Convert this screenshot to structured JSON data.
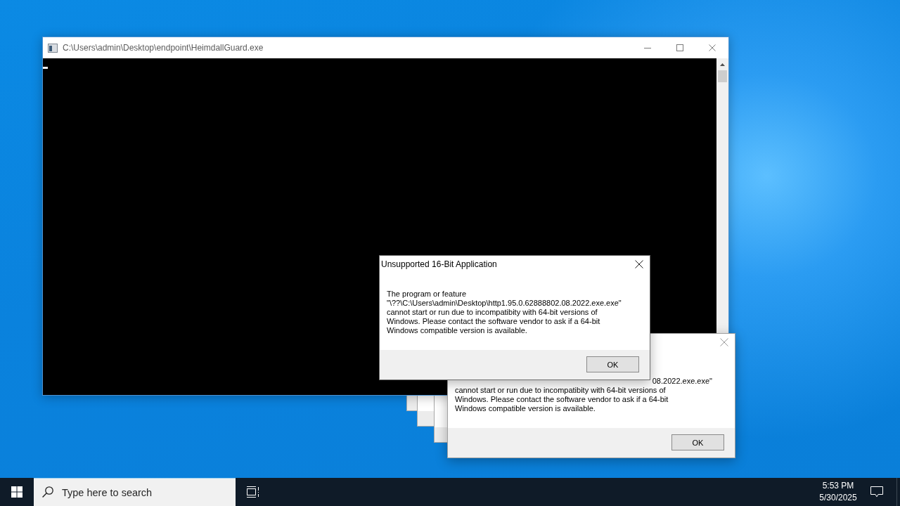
{
  "console_window": {
    "title": "C:\\Users\\admin\\Desktop\\endpoint\\HeimdallGuard.exe"
  },
  "dialog_behind": {
    "message_fragment": "08.2022.exe.exe\"",
    "message": "cannot start or run due to incompatibity with 64-bit versions of\nWindows. Please contact the software vendor to ask if a 64-bit\nWindows compatible version is available.",
    "button": "OK"
  },
  "dialog": {
    "title": "Unsupported 16-Bit Application",
    "message": "The program or feature\n\"\\??\\C:\\Users\\admin\\Desktop\\http1.95.0.62888802.08.2022.exe.exe\"\ncannot start or run due to incompatibity with 64-bit versions of\nWindows. Please contact the software vendor to ask if a 64-bit\nWindows compatible version is available.",
    "button": "OK"
  },
  "taskbar": {
    "search": {
      "placeholder": "Type here to search"
    },
    "clock": {
      "time": "5:53 PM",
      "date": "5/30/2025"
    }
  }
}
